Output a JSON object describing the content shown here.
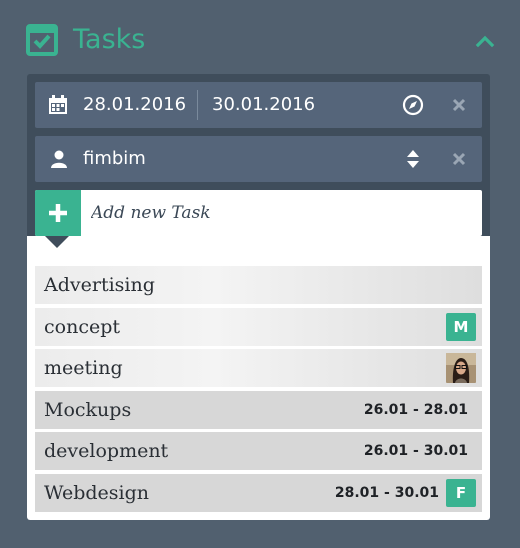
{
  "header": {
    "title": "Tasks",
    "collapse_icon": "chevron-up-icon",
    "logo_icon": "checkbox-icon",
    "accent_color": "#3ab391"
  },
  "filters": {
    "date_from": "28.01.2016",
    "date_to": "30.01.2016",
    "calendar_icon": "calendar-icon",
    "compass_icon": "compass-icon",
    "clear_icon": "close-icon",
    "user": "fimbim",
    "user_icon": "user-icon",
    "sort_icon": "sort-arrows-icon"
  },
  "add_task": {
    "placeholder": "Add new Task",
    "button_icon": "plus-icon"
  },
  "tasks": [
    {
      "name": "Advertising",
      "dates": "",
      "badge": ""
    },
    {
      "name": "concept",
      "dates": "",
      "badge": "M"
    },
    {
      "name": "meeting",
      "dates": "",
      "badge": "",
      "avatar": "avatar-photo"
    },
    {
      "name": "Mockups",
      "dates": "26.01 - 28.01",
      "badge": ""
    },
    {
      "name": "development",
      "dates": "26.01 - 30.01",
      "badge": ""
    },
    {
      "name": "Webdesign",
      "dates": "28.01 - 30.01",
      "badge": "F"
    }
  ]
}
